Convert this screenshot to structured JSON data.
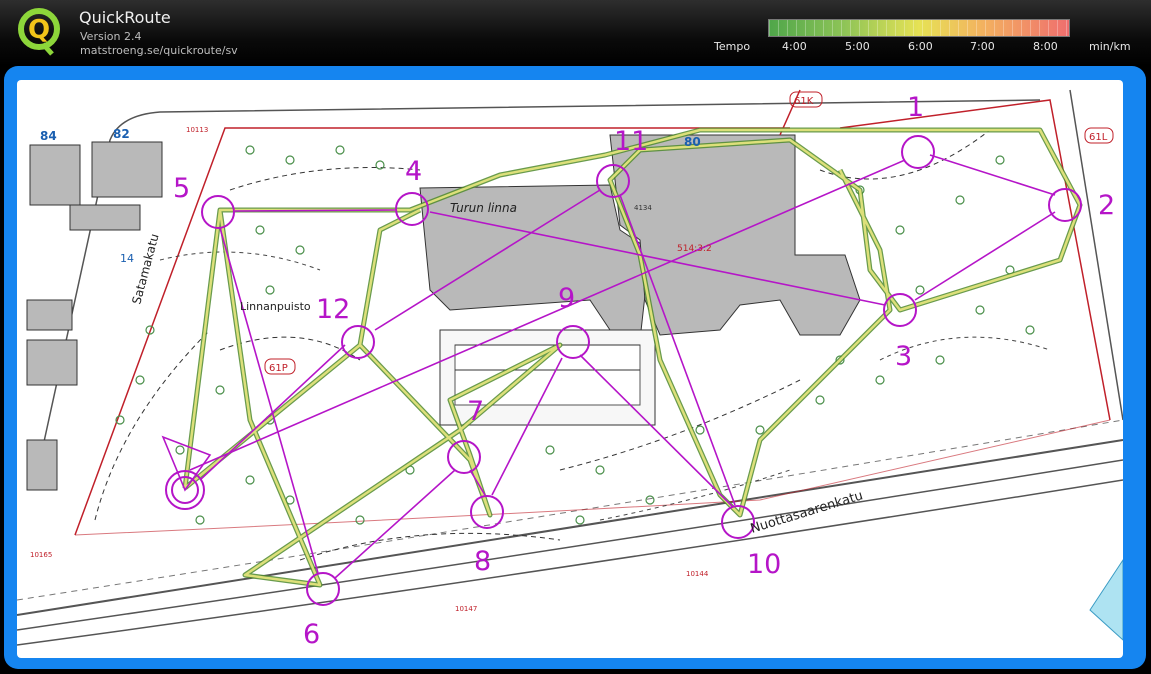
{
  "app": {
    "title": "QuickRoute",
    "version": "Version 2.4",
    "url": "matstroeng.se/quickroute/sv"
  },
  "legend": {
    "tempo_label": "Tempo",
    "unit_label": "min/km",
    "ticks": [
      "4:00",
      "5:00",
      "6:00",
      "7:00",
      "8:00"
    ]
  },
  "map": {
    "control_numbers": [
      "1",
      "2",
      "3",
      "4",
      "5",
      "6",
      "7",
      "8",
      "9",
      "10",
      "11",
      "12"
    ],
    "place_names": {
      "castle": "Turun linna",
      "park": "Linnanpuisto",
      "street_left": "Satamakatu",
      "street_bottom": "Nuottasaarenkatu"
    },
    "building_numbers": [
      "84",
      "82",
      "80",
      "14"
    ],
    "area_codes": [
      "61K",
      "61L",
      "61P"
    ],
    "parcel_label": "514:3:2",
    "small_labels": [
      "10113",
      "4134",
      "10144",
      "10147",
      "10165"
    ],
    "colors": {
      "course": "#b515c8",
      "route": "#4f8a2e",
      "route_fill": "#dde07a",
      "boundary": "#c0202a",
      "building": "#b9b9b9"
    }
  }
}
